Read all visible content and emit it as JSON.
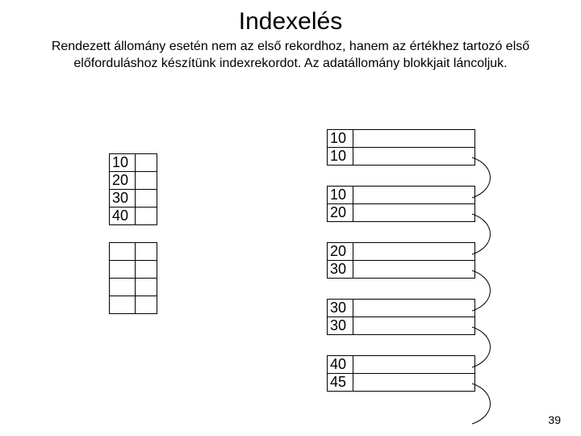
{
  "title": "Indexelés",
  "subtitle_line1": "Rendezett állomány esetén nem az első rekordhoz, hanem az értékhez tartozó első",
  "subtitle_line2": "előforduláshoz készítünk indexrekordot. Az adatállomány blokkjait láncoljuk.",
  "index": {
    "r1": "10",
    "r2": "20",
    "r3": "30",
    "r4": "40"
  },
  "block1": {
    "r1": "10",
    "r2": "10"
  },
  "block2": {
    "r1": "10",
    "r2": "20"
  },
  "block3": {
    "r1": "20",
    "r2": "30"
  },
  "block4": {
    "r1": "30",
    "r2": "30"
  },
  "block5": {
    "r1": "40",
    "r2": "45"
  },
  "page_number": "39"
}
